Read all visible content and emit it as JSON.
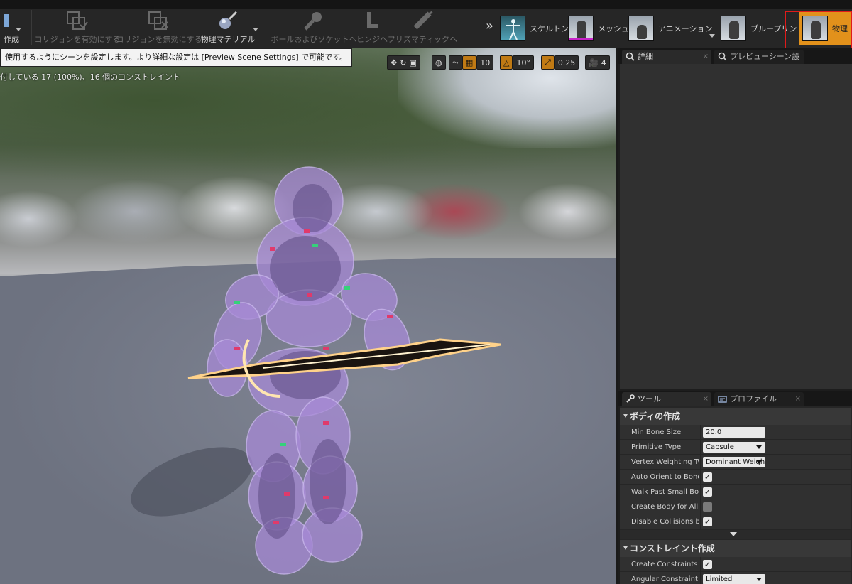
{
  "toolbar": {
    "create_label": "作成",
    "collision_enable_label": "コリジョンを有効にする",
    "collision_disable_label": "コリジョンを無効にする",
    "physics_material_label": "物理マテリアル",
    "ball_socket_label": "ボールおよびソケットへ",
    "hinge_label": "ヒンジへ",
    "prismatic_label": "プリズマティックへ",
    "more_label": "»",
    "modes": [
      {
        "label": "スケルトン",
        "icon": "skeleton-icon",
        "bar_color": "#00000000"
      },
      {
        "label": "メッシュ",
        "icon": "mesh-icon",
        "bar_color": "#c822c8"
      },
      {
        "label": "アニメーション",
        "icon": "animation-icon",
        "bar_color": "#00000000"
      },
      {
        "label": "ブループリント",
        "icon": "blueprint-icon",
        "bar_color": "#00000000"
      },
      {
        "label": "物理",
        "icon": "physics-icon",
        "bar_color": "#e2911b",
        "active": true
      }
    ]
  },
  "viewport": {
    "tooltip": "使用するようにシーンを設定します。より詳細な設定は [Preview Scene Settings] で可能です。",
    "info_text": "付している 17 (100%)、16 個のコンストレイント",
    "grid_snap": "10",
    "rotation_snap": "10°",
    "scale_snap": "0.25",
    "camera_speed": "4"
  },
  "details_panel": {
    "tabs": [
      {
        "label": "詳細",
        "icon": "search-icon"
      },
      {
        "label": "プレビューシーン設",
        "icon": "search-icon"
      }
    ]
  },
  "tools_panel": {
    "tabs": [
      {
        "label": "ツール",
        "icon": "wrench-icon"
      },
      {
        "label": "プロファイル",
        "icon": "profile-icon"
      }
    ],
    "body_section": {
      "title": "ボディの作成",
      "min_bone_size_label": "Min Bone Size",
      "min_bone_size_value": "20.0",
      "primitive_type_label": "Primitive Type",
      "primitive_type_value": "Capsule",
      "vertex_weighting_label": "Vertex Weighting Type",
      "vertex_weighting_value": "Dominant Weight",
      "auto_orient_label": "Auto Orient to Bone",
      "auto_orient_checked": true,
      "walk_past_label": "Walk Past Small Bones",
      "walk_past_checked": true,
      "create_body_all_label": "Create Body for All Bones",
      "create_body_all_checked": false,
      "disable_collisions_label": "Disable Collisions by Default",
      "disable_collisions_checked": true
    },
    "constraint_section": {
      "title": "コンストレイント作成",
      "create_constraints_label": "Create Constraints",
      "create_constraints_checked": true,
      "angular_mode_label": "Angular Constraint Mode",
      "angular_mode_value": "Limited"
    }
  }
}
